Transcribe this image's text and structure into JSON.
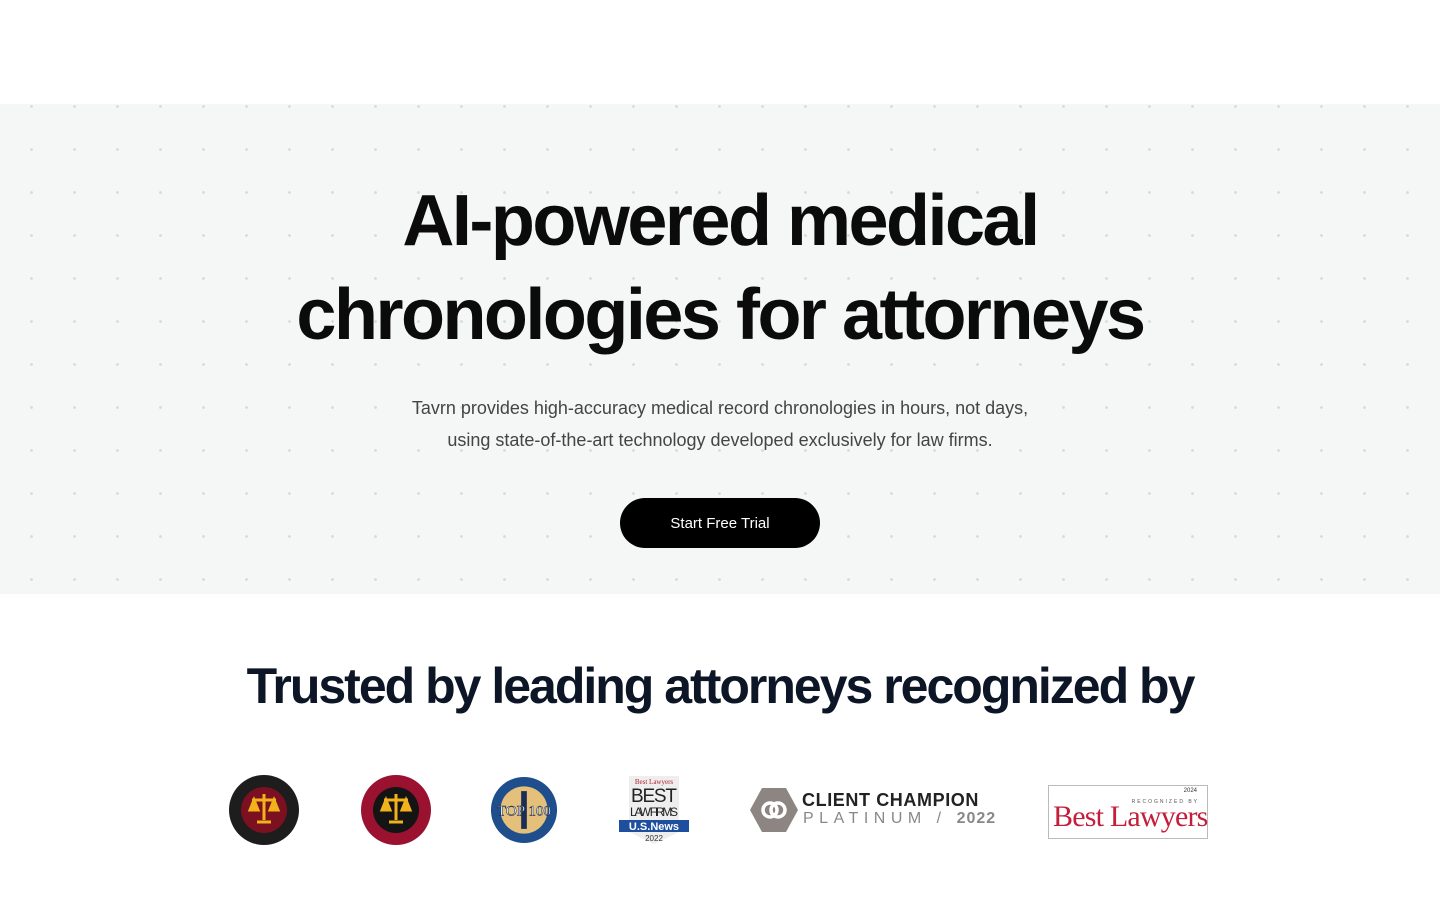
{
  "hero": {
    "title_line1": "AI-powered medical",
    "title_line2": "chronologies for attorneys",
    "subtitle_line1": "Tavrn provides high-accuracy medical record chronologies in hours, not days,",
    "subtitle_line2": "using state-of-the-art technology developed exclusively for law firms.",
    "cta_label": "Start Free Trial"
  },
  "trusted": {
    "heading": "Trusted by leading attorneys recognized by"
  },
  "logos": {
    "million_dollar": "Million Dollar Advocates Forum",
    "multi_million": "Multi-Million Dollar Advocates Forum",
    "top100": "The National Top 100 Trial Lawyers",
    "best_law_firms": "Best Lawyers Best Law Firms U.S.News 2022",
    "client_champion_line1": "CLIENT CHAMPION",
    "client_champion_platinum": "PLATINUM /",
    "client_champion_year": "2022",
    "best_lawyers_year": "2024",
    "best_lawyers_recognized": "RECOGNIZED BY",
    "best_lawyers_name": "Best Lawyers"
  },
  "colors": {
    "cta": "#000000",
    "hero_bg": "#f4f7f6",
    "heading": "#0d1626",
    "best_lawyers_red": "#c41e3a"
  }
}
